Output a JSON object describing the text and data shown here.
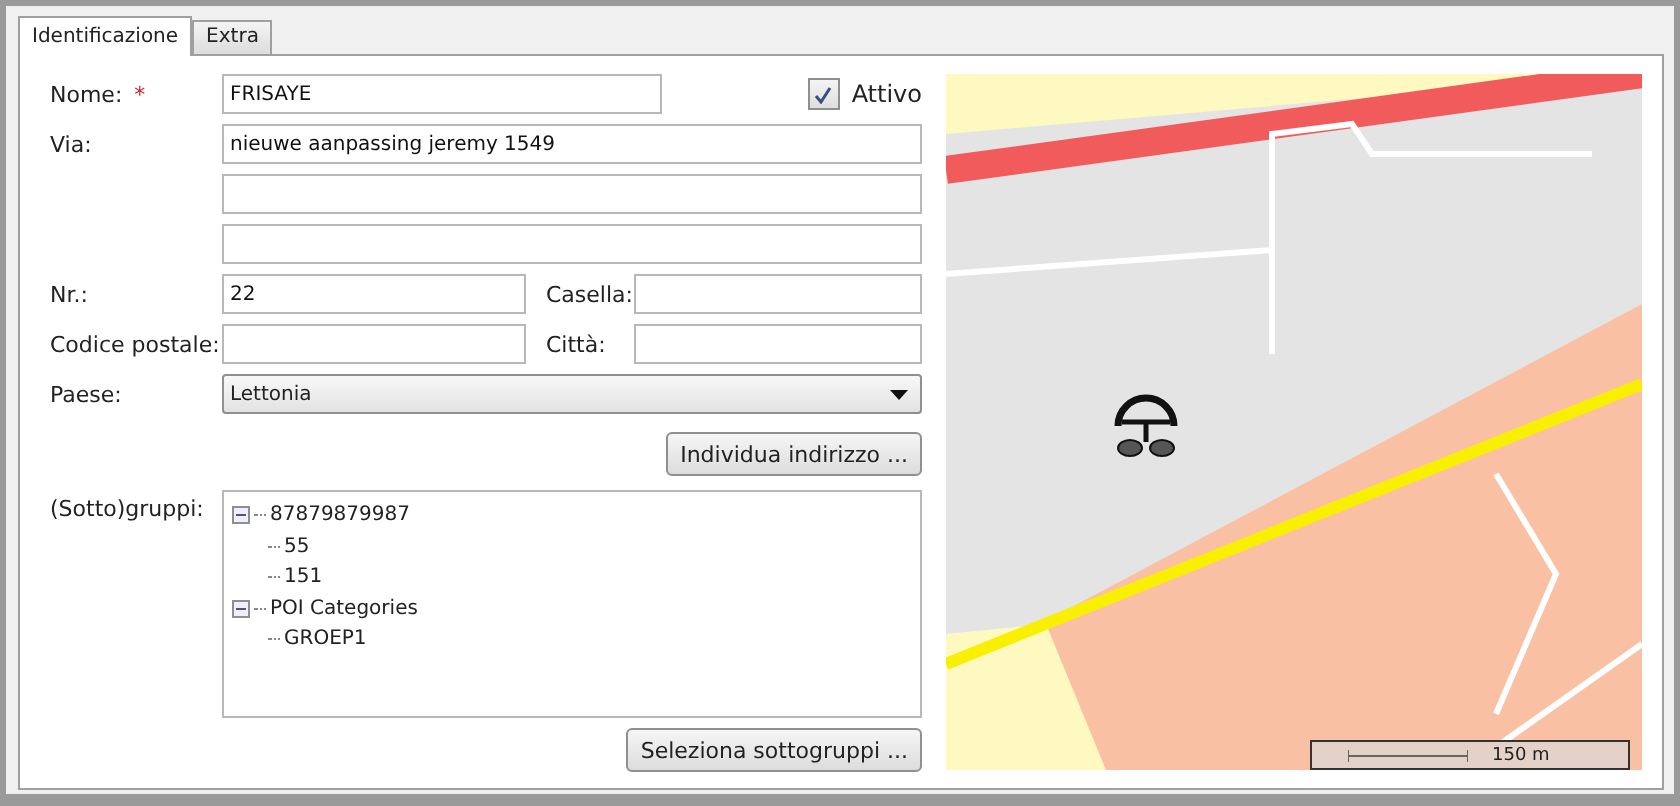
{
  "tabs": [
    {
      "label": "Identificazione",
      "selected": true
    },
    {
      "label": "Extra",
      "selected": false
    }
  ],
  "form": {
    "name_label": "Nome:",
    "required_mark": "*",
    "name_value": "FRISAYE",
    "active_label": "Attivo",
    "active_checked": true,
    "street_label": "Via:",
    "street_value": "nieuwe aanpassing jeremy 1549",
    "number_label": "Nr.:",
    "number_value": "22",
    "box_label": "Casella:",
    "postcode_label": "Codice postale:",
    "city_label": "Città:",
    "country_label": "Paese:",
    "country_value": "Lettonia",
    "locate_button": "Individua indirizzo ...",
    "groups_label": "(Sotto)gruppi:",
    "groups": [
      {
        "label": "87879879987",
        "expanded": true,
        "children": [
          {
            "label": "55"
          },
          {
            "label": "151"
          }
        ]
      },
      {
        "label": "POI Categories",
        "expanded": true,
        "children": [
          {
            "label": "GROEP1"
          }
        ]
      }
    ],
    "select_button": "Seleziona sottogruppi ..."
  },
  "map": {
    "scale": "150 m"
  }
}
